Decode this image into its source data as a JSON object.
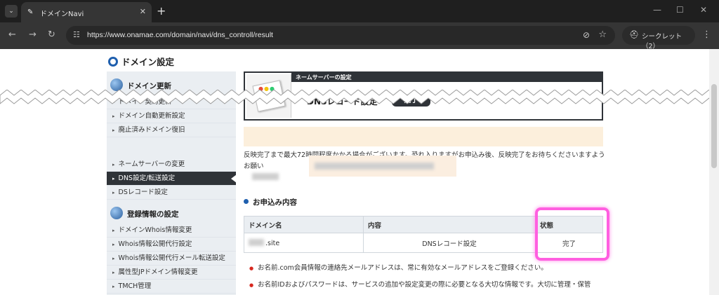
{
  "browser": {
    "tab_title": "ドメインNavi",
    "url": "https://www.onamae.com/domain/navi/dns_controll/result",
    "incognito_label": "シークレット（2）"
  },
  "page": {
    "section_title": "ドメイン設定",
    "sidebar": {
      "groups": [
        {
          "heading": "ドメイン更新",
          "items": [
            "ドメイン契約更新",
            "ドメイン自動更新設定",
            "廃止済みドメイン復旧"
          ]
        },
        {
          "items": [
            "ネームサーバーの変更",
            "DNS設定/転送設定",
            "DSレコード設定"
          ],
          "active_index": 1
        },
        {
          "heading": "登録情報の設定",
          "items": [
            "ドメインWhois情報変更",
            "Whois情報公開代行設定",
            "Whois情報公開代行メール転送設定",
            "属性型JPドメイン情報変更",
            "TMCH管理"
          ]
        }
      ]
    },
    "ns_box": {
      "header": "ネームサーバーの設定",
      "title": "DNSレコード設定",
      "badge": "完了"
    },
    "info_text": "反映完了まで最大72時間程度かかる場合がございます。恐れ入りますがお申込み後、反映完了をお待ちくださいますようお願い",
    "order": {
      "heading": "お申込み内容",
      "columns": [
        "ドメイン名",
        "内容",
        "状態"
      ],
      "rows": [
        {
          "domain": ".site",
          "content": "DNSレコード設定",
          "status": "完了"
        }
      ]
    },
    "notes": [
      "お名前.com会員情報の連絡先メールアドレスは、常に有効なメールアドレスをご登録ください。",
      "お名前IDおよびパスワードは、サービスの追加や設定変更の際に必要となる大切な情報です。大切に管理・保管"
    ],
    "colors": {
      "accent": "#1f5fae",
      "dark": "#2f3338",
      "highlight": "#ff5fe0"
    }
  }
}
